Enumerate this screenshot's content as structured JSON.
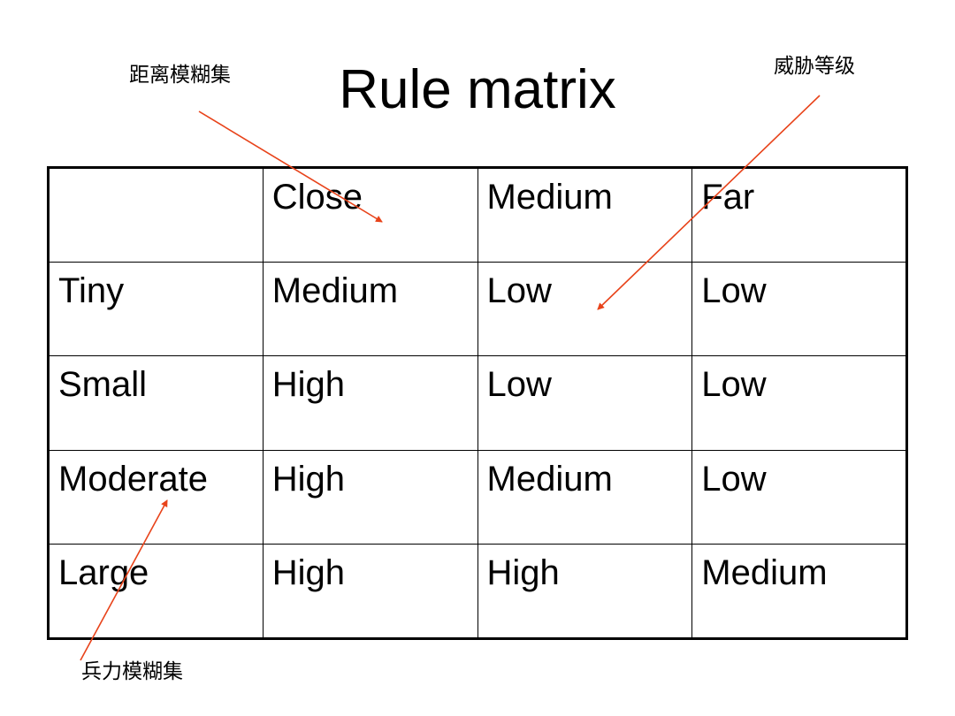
{
  "title": "Rule matrix",
  "annotations": {
    "distance_fuzzy_set": "距离模糊集",
    "threat_level": "威胁等级",
    "force_fuzzy_set": "兵力模糊集"
  },
  "table": {
    "header": [
      "",
      "Close",
      "Medium",
      "Far"
    ],
    "rows": [
      [
        "Tiny",
        "Medium",
        "Low",
        "Low"
      ],
      [
        "Small",
        "High",
        "Low",
        "Low"
      ],
      [
        "Moderate",
        "High",
        "Medium",
        "Low"
      ],
      [
        "Large",
        "High",
        "High",
        "Medium"
      ]
    ]
  },
  "colors": {
    "arrow": "#e8431a",
    "text": "#000000",
    "background": "#ffffff"
  }
}
